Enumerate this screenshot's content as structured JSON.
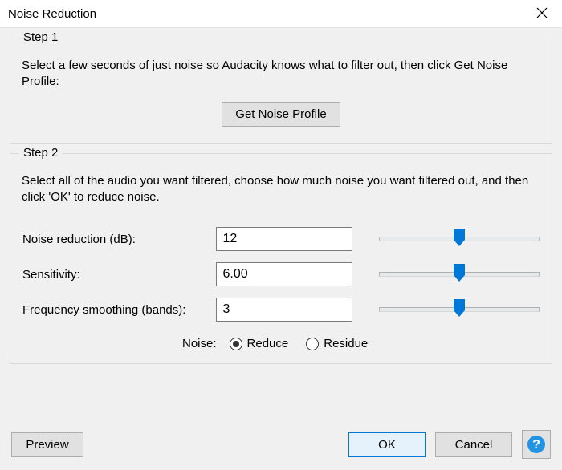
{
  "window": {
    "title": "Noise Reduction"
  },
  "step1": {
    "legend": "Step 1",
    "instruction": "Select a few seconds of just noise so Audacity knows what to filter out, then click Get Noise Profile:",
    "get_profile_label": "Get Noise Profile"
  },
  "step2": {
    "legend": "Step 2",
    "instruction": "Select all of the audio you want filtered, choose how much noise you want filtered out, and then click 'OK' to reduce noise.",
    "rows": {
      "noise_reduction": {
        "label": "Noise reduction (dB):",
        "value": "12",
        "slider_pct": 50
      },
      "sensitivity": {
        "label": "Sensitivity:",
        "value": "6.00",
        "slider_pct": 50
      },
      "freq_smoothing": {
        "label": "Frequency smoothing (bands):",
        "value": "3",
        "slider_pct": 50
      }
    },
    "noise_label": "Noise:",
    "radios": {
      "reduce": {
        "label": "Reduce",
        "checked": true
      },
      "residue": {
        "label": "Residue",
        "checked": false
      }
    }
  },
  "footer": {
    "preview": "Preview",
    "ok": "OK",
    "cancel": "Cancel"
  },
  "colors": {
    "accent": "#0078d7",
    "slider_thumb": "#0078d7",
    "panel_bg": "#f0f0f0",
    "help_fill": "#2393e4"
  }
}
